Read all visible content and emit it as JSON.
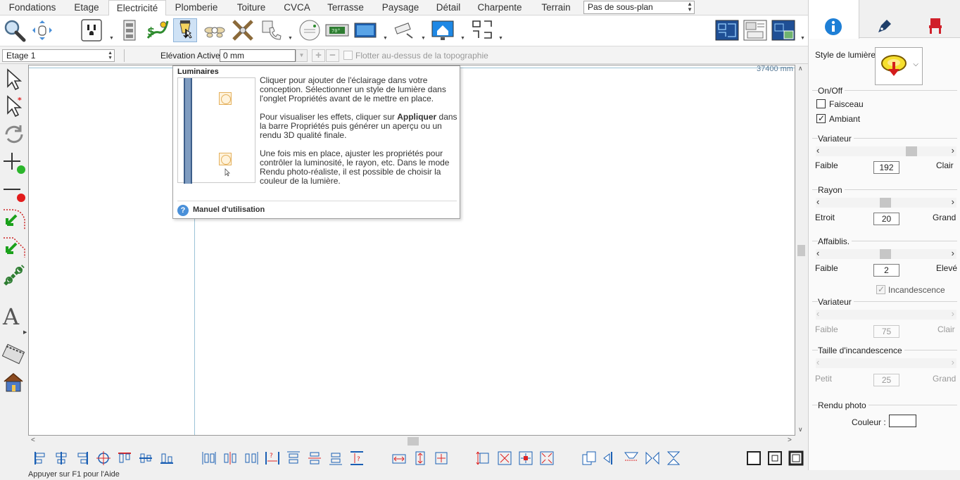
{
  "tabs": [
    "Fondations",
    "Etage",
    "Electricité",
    "Plomberie",
    "Toiture",
    "CVCA",
    "Terrasse",
    "Paysage",
    "Détail",
    "Charpente",
    "Terrain"
  ],
  "active_tab": "Electricité",
  "subplan": {
    "value": "Pas de sous-plan"
  },
  "floor_select": {
    "value": "Etage 1"
  },
  "elevation": {
    "label": "Elévation Active:",
    "value": "0 mm"
  },
  "float_topo": {
    "label": "Flotter au-dessus de la topographie",
    "checked": false
  },
  "canvas": {
    "ruler_value": "37400 mm"
  },
  "tooltip": {
    "title": "Luminaires",
    "para1": "Cliquer pour ajouter de l'éclairage dans votre conception. Sélectionner un style de lumière dans l'onglet Propriétés avant de le mettre en place.",
    "para2_pre": "Pour visualiser les effets, cliquer sur ",
    "para2_bold": "Appliquer",
    "para2_post": " dans la barre Propriétés puis générer un aperçu ou un rendu 3D qualité finale.",
    "para3": "Une fois mis en place, ajuster les propriétés pour contrôler la luminosité, le rayon, etc. Dans le mode Rendu photo-réaliste, il est possible de choisir la couleur de la lumière.",
    "help_link": "Manuel d'utilisation",
    "help_glyph": "?"
  },
  "status_text": "Appuyer sur F1 pour l'Aide",
  "properties": {
    "style_label": "Style de lumière",
    "onoff": {
      "title": "On/Off",
      "faisceau": "Faisceau",
      "faisceau_checked": false,
      "ambiant": "Ambiant",
      "ambiant_checked": true
    },
    "variateur": {
      "title": "Variateur",
      "min_label": "Faible",
      "max_label": "Clair",
      "value": "192",
      "position": 0.83
    },
    "rayon": {
      "title": "Rayon",
      "min_label": "Etroit",
      "max_label": "Grand",
      "value": "20",
      "position": 0.55
    },
    "affaiblis": {
      "title": "Affaiblis.",
      "min_label": "Faible",
      "max_label": "Elevé",
      "value": "2",
      "position": 0.55
    },
    "incandescence": {
      "label": "Incandescence",
      "checked": true,
      "disabled": true
    },
    "variateur2": {
      "title": "Variateur",
      "min_label": "Faible",
      "max_label": "Clair",
      "value": "75",
      "disabled": true
    },
    "taille": {
      "title": "Taille d'incandescence",
      "min_label": "Petit",
      "max_label": "Grand",
      "value": "25",
      "disabled": true
    },
    "rendu": {
      "title": "Rendu photo",
      "couleur_label": "Couleur :",
      "color": "#ffffff"
    }
  },
  "colors": {
    "accent_blue": "#1a5fb4",
    "info_tab": "#1e7fd6",
    "chair_red": "#d0202a",
    "tooltip_help": "#4a90d9"
  }
}
